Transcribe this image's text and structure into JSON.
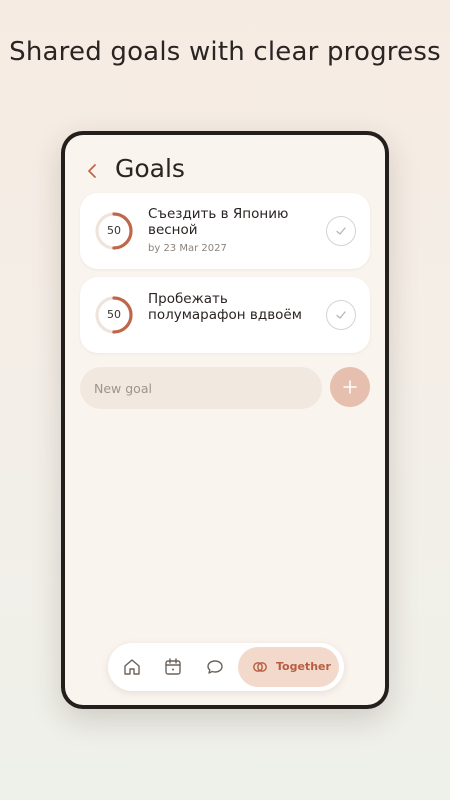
{
  "headline": "Shared goals with clear progress",
  "header": {
    "back_icon": "chevron-left-icon",
    "title": "Goals"
  },
  "goals": [
    {
      "title": "Съездить в Японию весной",
      "due": "by 23 Mar 2027",
      "progress": 50,
      "progress_label": "50",
      "completed": false
    },
    {
      "title": "Пробежать полумарафон вдвоём",
      "due": "",
      "progress": 50,
      "progress_label": "50",
      "completed": false
    }
  ],
  "new_goal": {
    "placeholder": "New goal",
    "value": "",
    "add_icon": "plus-icon"
  },
  "tabbar": {
    "items": [
      {
        "icon": "home-icon"
      },
      {
        "icon": "calendar-icon"
      },
      {
        "icon": "chat-icon"
      },
      {
        "icon": "together-icon",
        "label": "Together",
        "active": true
      }
    ]
  },
  "colors": {
    "accent": "#c0664a",
    "ring_track": "#efe4dc",
    "add_button": "#e6bfae",
    "active_tab_bg": "#f2d9cc",
    "screen_bg": "#faf4ef"
  }
}
